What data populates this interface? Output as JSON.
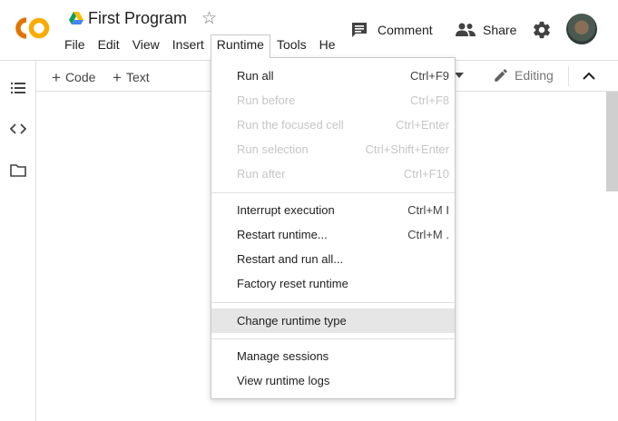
{
  "header": {
    "logo_text": "CO",
    "title": "First Program",
    "menu": [
      {
        "label": "File"
      },
      {
        "label": "Edit"
      },
      {
        "label": "View"
      },
      {
        "label": "Insert"
      },
      {
        "label": "Runtime"
      },
      {
        "label": "Tools"
      },
      {
        "label": "He"
      }
    ],
    "comment_label": "Comment",
    "share_label": "Share"
  },
  "toolbar": {
    "code_label": "Code",
    "text_label": "Text",
    "editing_label": "Editing"
  },
  "runtime_menu": {
    "items": [
      {
        "label": "Run all",
        "shortcut": "Ctrl+F9",
        "enabled": true
      },
      {
        "label": "Run before",
        "shortcut": "Ctrl+F8",
        "enabled": false
      },
      {
        "label": "Run the focused cell",
        "shortcut": "Ctrl+Enter",
        "enabled": false
      },
      {
        "label": "Run selection",
        "shortcut": "Ctrl+Shift+Enter",
        "enabled": false
      },
      {
        "label": "Run after",
        "shortcut": "Ctrl+F10",
        "enabled": false
      },
      {
        "label": "Interrupt execution",
        "shortcut": "Ctrl+M I",
        "enabled": true
      },
      {
        "label": "Restart runtime...",
        "shortcut": "Ctrl+M .",
        "enabled": true
      },
      {
        "label": "Restart and run all...",
        "shortcut": "",
        "enabled": true
      },
      {
        "label": "Factory reset runtime",
        "shortcut": "",
        "enabled": true
      },
      {
        "label": "Change runtime type",
        "shortcut": "",
        "enabled": true,
        "highlighted": true
      },
      {
        "label": "Manage sessions",
        "shortcut": "",
        "enabled": true
      },
      {
        "label": "View runtime logs",
        "shortcut": "",
        "enabled": true
      }
    ]
  },
  "colors": {
    "logo_orange": "#f9ab00",
    "logo_dark_orange": "#e37400",
    "highlight_row": "#e6e6e6",
    "disabled_text": "#c6c6c6"
  },
  "icons": [
    "drive-icon",
    "star-icon",
    "comment-icon",
    "share-people-icon",
    "gear-icon",
    "toc-icon",
    "code-brackets-icon",
    "folder-icon",
    "pencil-icon",
    "chevron-up-icon",
    "caret-down-icon"
  ]
}
